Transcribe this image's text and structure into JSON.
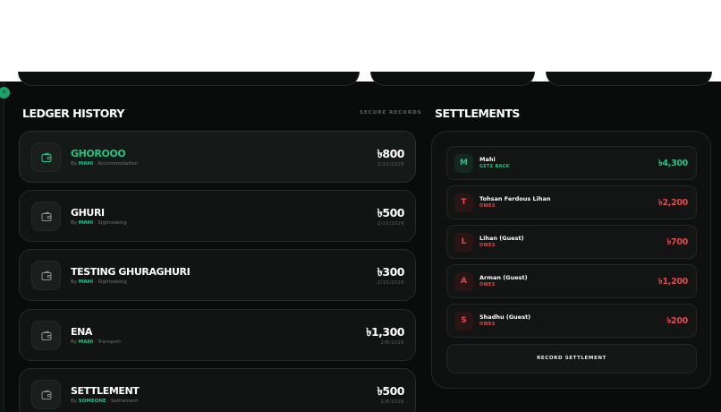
{
  "ledger": {
    "title": "LEDGER HISTORY",
    "secure_label": "SECURE RECORDS",
    "by_prefix": "By",
    "separator": "·",
    "entries": [
      {
        "name": "GHOROOO",
        "by": "MAHI",
        "category": "Accommodation",
        "amount": "৳800",
        "date": "2/10/2026",
        "highlight": true
      },
      {
        "name": "GHURI",
        "by": "MAHI",
        "category": "Sightseeing",
        "amount": "৳500",
        "date": "2/10/2026",
        "highlight": false
      },
      {
        "name": "TESTING GHURAGHURI",
        "by": "MAHI",
        "category": "Sightseeing",
        "amount": "৳300",
        "date": "2/10/2026",
        "highlight": false
      },
      {
        "name": "ENA",
        "by": "MAHI",
        "category": "Transport",
        "amount": "৳1,300",
        "date": "2/8/2026",
        "highlight": false
      },
      {
        "name": "SETTLEMENT",
        "by": "SOMEONE",
        "category": "Settlement",
        "amount": "৳500",
        "date": "2/8/2026",
        "highlight": false
      }
    ]
  },
  "settlements": {
    "title": "SETTLEMENTS",
    "rows": [
      {
        "initial": "M",
        "name": "Mahi",
        "status": "GETS BACK",
        "amount": "৳4,300",
        "tone": "g"
      },
      {
        "initial": "T",
        "name": "Tohsan Ferdous Lihan",
        "status": "OWES",
        "amount": "৳2,200",
        "tone": "r"
      },
      {
        "initial": "L",
        "name": "Lihan (Guest)",
        "status": "OWES",
        "amount": "৳700",
        "tone": "r"
      },
      {
        "initial": "A",
        "name": "Arman (Guest)",
        "status": "OWES",
        "amount": "৳1,200",
        "tone": "r"
      },
      {
        "initial": "S",
        "name": "Shadhu (Guest)",
        "status": "OWES",
        "amount": "৳200",
        "tone": "r"
      }
    ],
    "record_button": "RECORD SETTLEMENT"
  },
  "sidebar": {
    "toggle_icon": "‹"
  },
  "colors": {
    "accent": "#22c382",
    "debt": "#e5484d",
    "background": "#0a0c0b"
  },
  "icons": {
    "entry": "wallet-icon",
    "toggle": "chevron-left-icon"
  }
}
